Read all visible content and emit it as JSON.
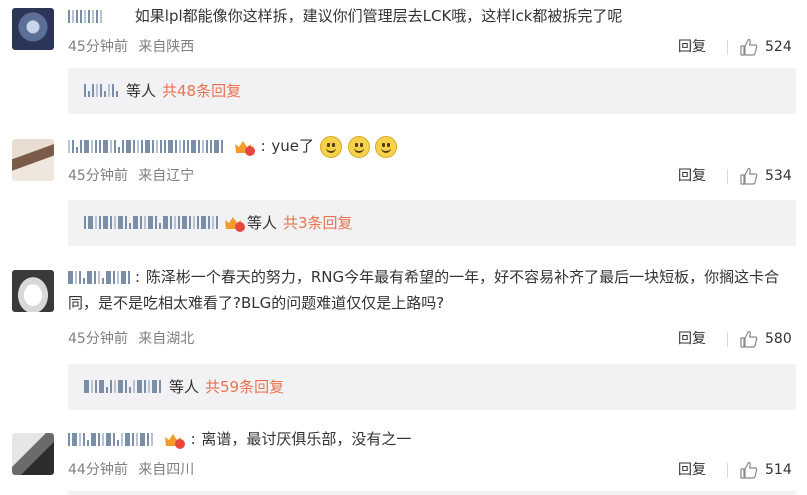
{
  "labels": {
    "reply": "回复",
    "others": "等人"
  },
  "comments": [
    {
      "text": "如果lpl都能像你这样拆，建议你们管理层去LCK哦，这样lck都被拆完了呢",
      "time": "45分钟前",
      "location": "来自陕西",
      "likes": "524",
      "sub_count": "共48条回复"
    },
    {
      "text": "yue了",
      "time": "45分钟前",
      "location": "来自辽宁",
      "likes": "534",
      "sub_count": "共3条回复"
    },
    {
      "text": "陈泽彬一个春天的努力，RNG今年最有希望的一年，好不容易补齐了最后一块短板，你搁这卡合同，是不是吃相太难看了?BLG的问题难道仅仅是上路吗?",
      "time": "45分钟前",
      "location": "来自湖北",
      "likes": "580",
      "sub_count": "共59条回复"
    },
    {
      "text": "离谱，最讨厌俱乐部，没有之一",
      "time": "44分钟前",
      "location": "来自四川",
      "likes": "514"
    }
  ],
  "colors": {
    "accent": "#eb7350",
    "meta": "#808080",
    "subbox_bg": "#f2f2f5",
    "username": "#7a8ea8"
  },
  "icons": [
    "thumbs-up-icon",
    "vip-badge-icon",
    "smile-emoji-icon"
  ]
}
